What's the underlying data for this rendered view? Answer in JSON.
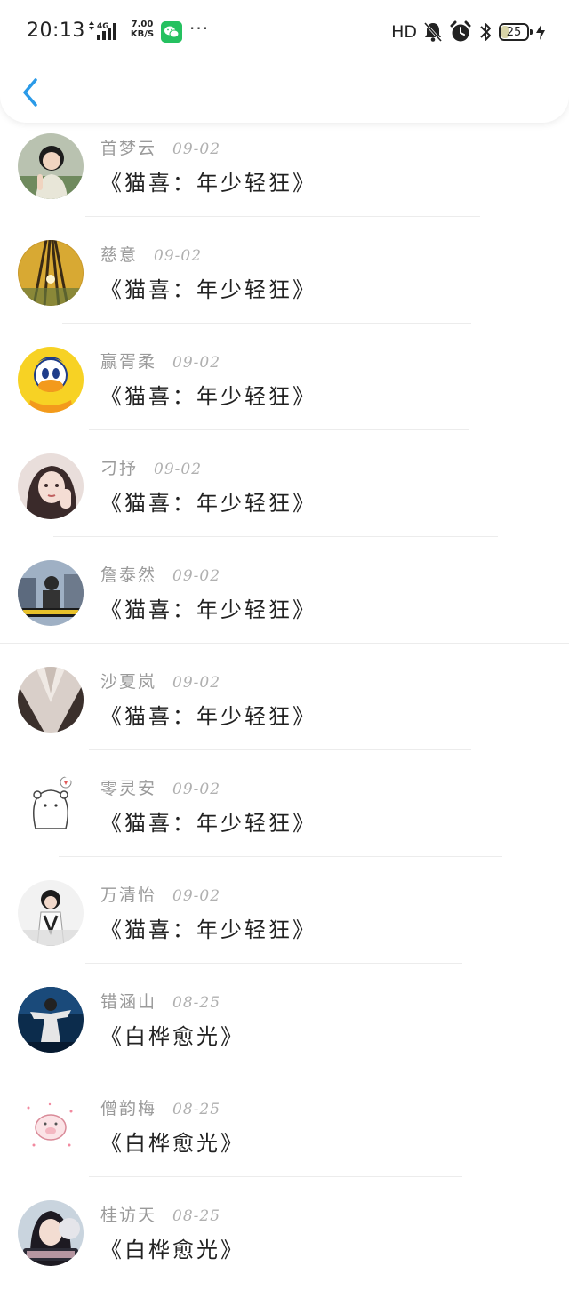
{
  "status_bar": {
    "time": "20:13",
    "network_type": "4G",
    "speed_value": "7.00",
    "speed_unit": "KB/S",
    "more": "···",
    "hd": "HD",
    "battery": "25"
  },
  "header": {
    "back_icon": "chevron-left-icon",
    "accent_color": "#2a9ae8"
  },
  "comments": [
    {
      "name": "首梦云",
      "date": "09-02",
      "title": "《猫喜：年少轻狂》",
      "avatar": "girl-photo-avatar"
    },
    {
      "name": "慈意",
      "date": "09-02",
      "title": "《猫喜：年少轻狂》",
      "avatar": "forest-photo-avatar"
    },
    {
      "name": "赢胥柔",
      "date": "09-02",
      "title": "《猫喜：年少轻狂》",
      "avatar": "duck-cartoon-avatar"
    },
    {
      "name": "刁抒",
      "date": "09-02",
      "title": "《猫喜：年少轻狂》",
      "avatar": "woman-illustration-avatar"
    },
    {
      "name": "詹泰然",
      "date": "09-02",
      "title": "《猫喜：年少轻狂》",
      "avatar": "street-photo-avatar"
    },
    {
      "name": "沙夏岚",
      "date": "09-02",
      "title": "《猫喜：年少轻狂》",
      "avatar": "sweater-photo-avatar"
    },
    {
      "name": "零灵安",
      "date": "09-02",
      "title": "《猫喜：年少轻狂》",
      "avatar": "bear-sketch-avatar"
    },
    {
      "name": "万清怡",
      "date": "09-02",
      "title": "《猫喜：年少轻狂》",
      "avatar": "girl-text-avatar"
    },
    {
      "name": "错涵山",
      "date": "08-25",
      "title": "《白桦愈光》",
      "avatar": "performer-photo-avatar"
    },
    {
      "name": "僧韵梅",
      "date": "08-25",
      "title": "《白桦愈光》",
      "avatar": "pig-sketch-avatar"
    },
    {
      "name": "桂访天",
      "date": "08-25",
      "title": "《白桦愈光》",
      "avatar": "girl-hood-avatar"
    }
  ]
}
